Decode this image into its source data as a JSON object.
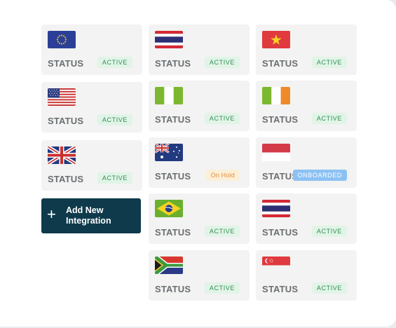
{
  "status_label": "STATUS",
  "add_integration": {
    "label": "Add New Integration",
    "icon": "plus-icon"
  },
  "columns": [
    [
      {
        "flag": "eu",
        "status": "ACTIVE",
        "state": "active"
      },
      {
        "flag": "us",
        "status": "ACTIVE",
        "state": "active"
      },
      {
        "flag": "uk",
        "status": "ACTIVE",
        "state": "active"
      }
    ],
    [
      {
        "flag": "th",
        "status": "ACTIVE",
        "state": "active"
      },
      {
        "flag": "ng",
        "status": "ACTIVE",
        "state": "active"
      },
      {
        "flag": "au",
        "status": "On Hold",
        "state": "hold"
      },
      {
        "flag": "br",
        "status": "ACTIVE",
        "state": "active"
      },
      {
        "flag": "za",
        "status": "ACTIVE",
        "state": "active"
      }
    ],
    [
      {
        "flag": "vn",
        "status": "ACTIVE",
        "state": "active"
      },
      {
        "flag": "ie",
        "status": "ACTIVE",
        "state": "active"
      },
      {
        "flag": "id",
        "status": "ONBOARDED",
        "state": "onboarded"
      },
      {
        "flag": "th",
        "status": "ACTIVE",
        "state": "active"
      },
      {
        "flag": "sg",
        "status": "ACTIVE",
        "state": "active"
      }
    ]
  ],
  "colors": {
    "card_bg": "#f2f3f2",
    "active_bg": "#e1f4e7",
    "active_text": "#2f8f56",
    "hold_bg": "#fcefd8",
    "hold_text": "#e0913a",
    "onboarded_bg": "#8cc1f4",
    "button_bg": "#0e3a4b"
  }
}
